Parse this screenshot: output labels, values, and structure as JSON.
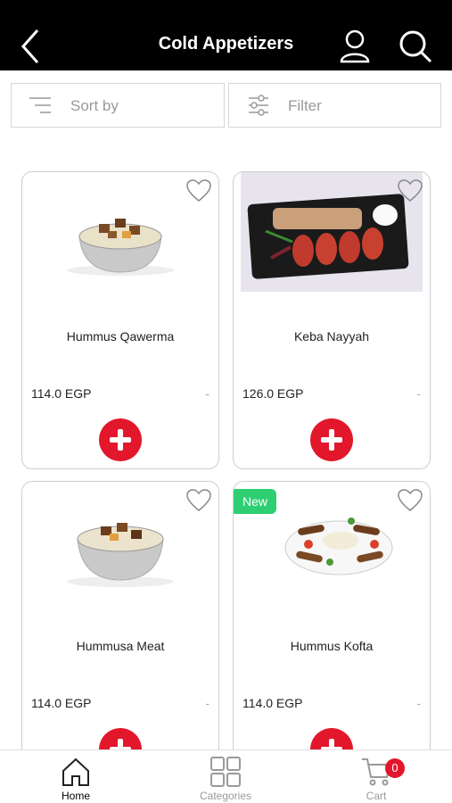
{
  "header": {
    "title": "Cold Appetizers"
  },
  "controls": {
    "sort_label": "Sort by",
    "filter_label": "Filter"
  },
  "products": [
    {
      "name": "Hummus Qawerma",
      "price": "114.0 EGP",
      "old_price": "-",
      "badge": ""
    },
    {
      "name": "Keba Nayyah",
      "price": "126.0 EGP",
      "old_price": "-",
      "badge": ""
    },
    {
      "name": "Hummusa Meat",
      "price": "114.0 EGP",
      "old_price": "-",
      "badge": ""
    },
    {
      "name": "Hummus Kofta",
      "price": "114.0 EGP",
      "old_price": "-",
      "badge": "New"
    }
  ],
  "bottom_nav": {
    "home": "Home",
    "categories": "Categories",
    "cart": "Cart",
    "cart_count": "0"
  },
  "colors": {
    "accent": "#e3172b",
    "new_badge": "#2ecf72",
    "header_bg": "#000000"
  }
}
